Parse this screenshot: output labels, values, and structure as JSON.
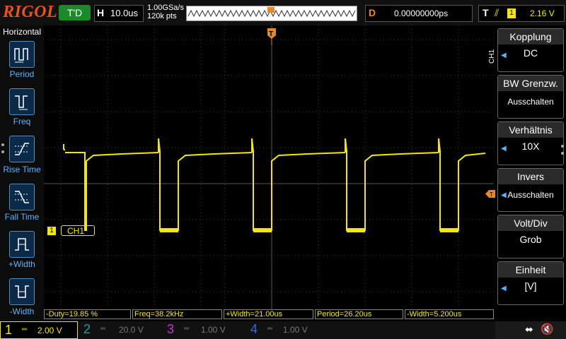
{
  "header": {
    "logo": "RIGOL",
    "run_state": "T'D",
    "h_label": "H",
    "timebase": "10.0us",
    "sample_rate": "1.00GSa/s",
    "memory_depth": "120k pts",
    "delay_label": "D",
    "delay_value": "0.00000000ps",
    "trigger_label": "T",
    "trigger_source": "1",
    "trigger_level": "2.16 V"
  },
  "left_panel": {
    "title": "Horizontal",
    "items": [
      {
        "label": "Period",
        "icon": "period-icon"
      },
      {
        "label": "Freq",
        "icon": "freq-icon"
      },
      {
        "label": "Rise Time",
        "icon": "rise-time-icon"
      },
      {
        "label": "Fall Time",
        "icon": "fall-time-icon"
      },
      {
        "label": "+Width",
        "icon": "pos-width-icon"
      },
      {
        "label": "-Width",
        "icon": "neg-width-icon"
      }
    ]
  },
  "screen": {
    "channel_label": "CH1",
    "channel_marker": "1",
    "trigger_marker": "T",
    "side_tab": "CH1"
  },
  "right_panel": {
    "items": [
      {
        "title": "Kopplung",
        "value": "DC"
      },
      {
        "title": "BW Grenzw.",
        "value": "Ausschalten"
      },
      {
        "title": "Verhältnis",
        "value": "10X"
      },
      {
        "title": "Invers",
        "value": "Ausschalten"
      },
      {
        "title": "Volt/Div",
        "value": "Grob"
      },
      {
        "title": "Einheit",
        "value": "[V]"
      }
    ]
  },
  "measurements": [
    "-Duty=19.85 %",
    "Freq=38.2kHz",
    "+Width=21.00us",
    "Period=26.20us",
    "-Width=5.200us"
  ],
  "channels": [
    {
      "num": "1",
      "scale": "2.00 V",
      "color": "#f5e800",
      "active": true
    },
    {
      "num": "2",
      "scale": "20.0 V",
      "color": "#2a9a9a",
      "active": false
    },
    {
      "num": "3",
      "scale": "1.00 V",
      "color": "#c03ad0",
      "active": false
    },
    {
      "num": "4",
      "scale": "1.00 V",
      "color": "#3a6ad0",
      "active": false
    }
  ],
  "colors": {
    "ch1": "#f5e800",
    "accent_orange": "#e8872a",
    "brand": "#e8541a"
  }
}
